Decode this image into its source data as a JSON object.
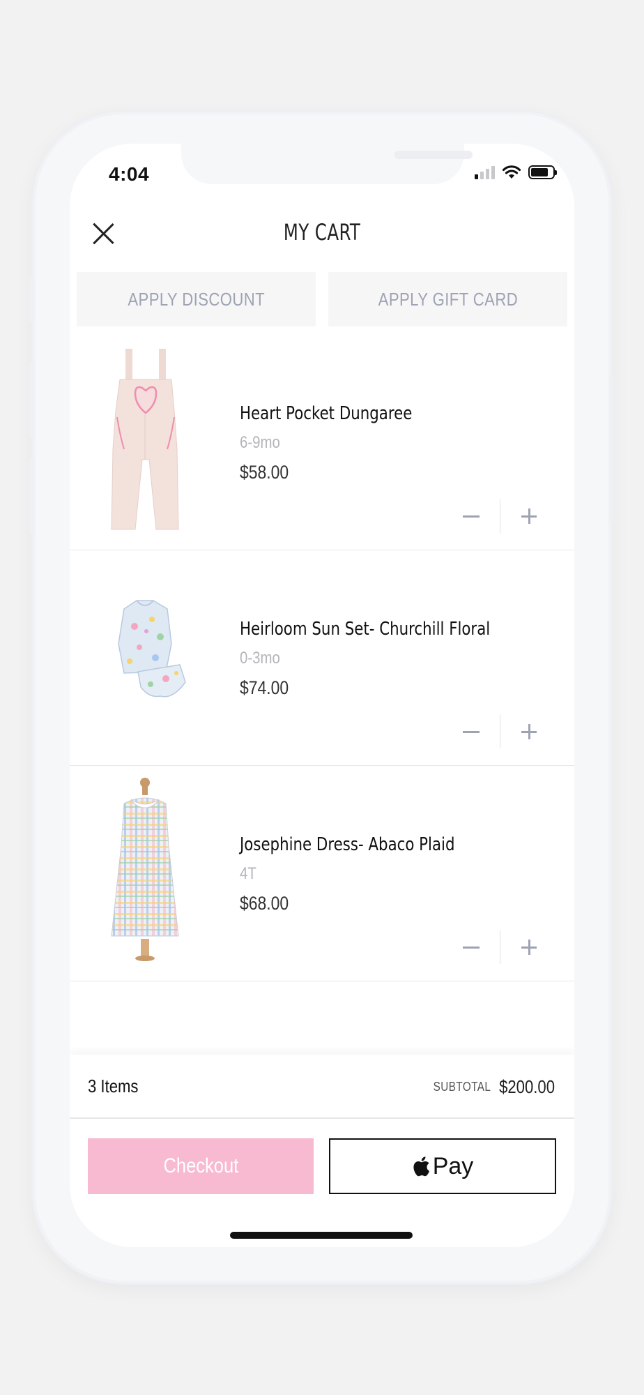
{
  "status_bar": {
    "time": "4:04"
  },
  "header": {
    "title": "MY CART"
  },
  "actions": {
    "apply_discount": "APPLY DISCOUNT",
    "apply_gift_card": "APPLY GIFT CARD"
  },
  "items": [
    {
      "name": "Heart Pocket Dungaree",
      "size": "6-9mo",
      "price": "$58.00"
    },
    {
      "name": "Heirloom Sun Set- Churchill Floral",
      "size": "0-3mo",
      "price": "$74.00"
    },
    {
      "name": "Josephine Dress- Abaco Plaid",
      "size": "4T",
      "price": "$68.00"
    }
  ],
  "summary": {
    "count": "3 Items",
    "subtotal_label": "SUBTOTAL",
    "subtotal_value": "$200.00"
  },
  "buttons": {
    "checkout": "Checkout",
    "apple_pay": "Pay"
  },
  "colors": {
    "checkout_bg": "#f7bad0",
    "muted_text": "#9ea3b4",
    "background": "#f2f2f2"
  }
}
